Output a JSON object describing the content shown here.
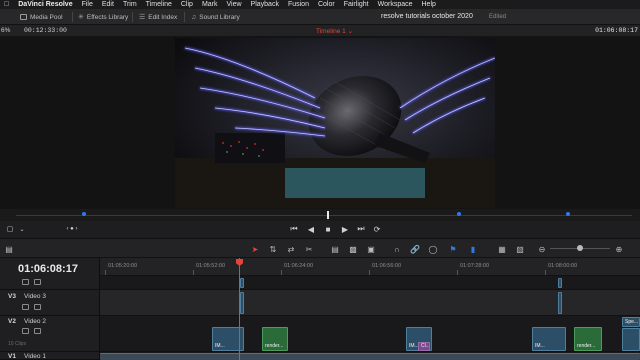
{
  "menubar": {
    "app": "DaVinci Resolve",
    "items": [
      "File",
      "Edit",
      "Trim",
      "Timeline",
      "Clip",
      "Mark",
      "View",
      "Playback",
      "Fusion",
      "Color",
      "Fairlight",
      "Workspace",
      "Help"
    ]
  },
  "toolbar": {
    "media_pool": "Media Pool",
    "effects_library": "Effects Library",
    "edit_index": "Edit Index",
    "sound_library": "Sound Library",
    "project_title": "resolve tutorials october 2020",
    "status": "Edited"
  },
  "viewer": {
    "zoom": "6%",
    "source_timecode": "00:12:33:00",
    "timeline_name": "Timeline 1",
    "record_timecode": "01:06:08:17"
  },
  "timeline": {
    "current_timecode": "01:06:08:17",
    "ruler": [
      "01:05:20:00",
      "01:05:52:00",
      "01:06:24:00",
      "01:06:56:00",
      "01:07:28:00",
      "01:08:00:00"
    ],
    "tracks": [
      {
        "id": "V3",
        "name": "Video 3",
        "clips_count": ""
      },
      {
        "id": "V2",
        "name": "Video 2",
        "clips_count": "10 Clips"
      },
      {
        "id": "V1",
        "name": "Video 1",
        "clips_count": ""
      }
    ],
    "clips": [
      {
        "label": "IM...",
        "kind": "image"
      },
      {
        "label": "render...",
        "kind": "generator"
      },
      {
        "label": "IM...",
        "kind": "image"
      },
      {
        "label": "Cl...",
        "kind": "other"
      },
      {
        "label": "IM...",
        "kind": "image"
      },
      {
        "label": "render...",
        "kind": "generator"
      },
      {
        "label": "Spe...",
        "kind": "other"
      }
    ]
  },
  "colors": {
    "accent_blue": "#2f7ae5",
    "playhead_red": "#e5443a",
    "clip_blue": "#2c4e66",
    "clip_green": "#2b6b3a"
  }
}
